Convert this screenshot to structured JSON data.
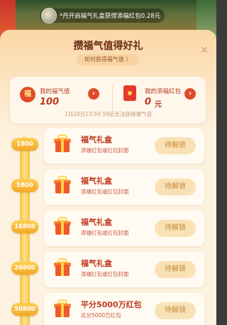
{
  "notification": {
    "text": "*丹开启福气礼盒获得添福红包0.28元"
  },
  "panel": {
    "title": "攒福气值得好礼",
    "how_link": "如何获得福气值 〉",
    "close_icon": "close-icon"
  },
  "stats": {
    "fortune_label": "我的福气值",
    "fortune_value": "100",
    "redpacket_label": "我的添福红包",
    "redpacket_value": "0",
    "redpacket_unit": "元",
    "arrow": "›",
    "fu_char": "福",
    "deadline": "1月20日23:59:59后无法获得福气值"
  },
  "rewards": [
    {
      "milestone": "1800",
      "name": "福气礼盒",
      "desc": "添福红包或红包封面",
      "button": "待解锁"
    },
    {
      "milestone": "5800",
      "name": "福气礼盒",
      "desc": "添福红包或红包封面",
      "button": "待解锁"
    },
    {
      "milestone": "16800",
      "name": "福气礼盒",
      "desc": "添福红包或红包封面",
      "button": "待解锁"
    },
    {
      "milestone": "26800",
      "name": "福气礼盒",
      "desc": "添福红包或红包封面",
      "button": "待解锁"
    },
    {
      "milestone": "50800",
      "name": "平分5000万红包",
      "desc": "瓜分5000万红包",
      "button": "待解锁"
    }
  ]
}
